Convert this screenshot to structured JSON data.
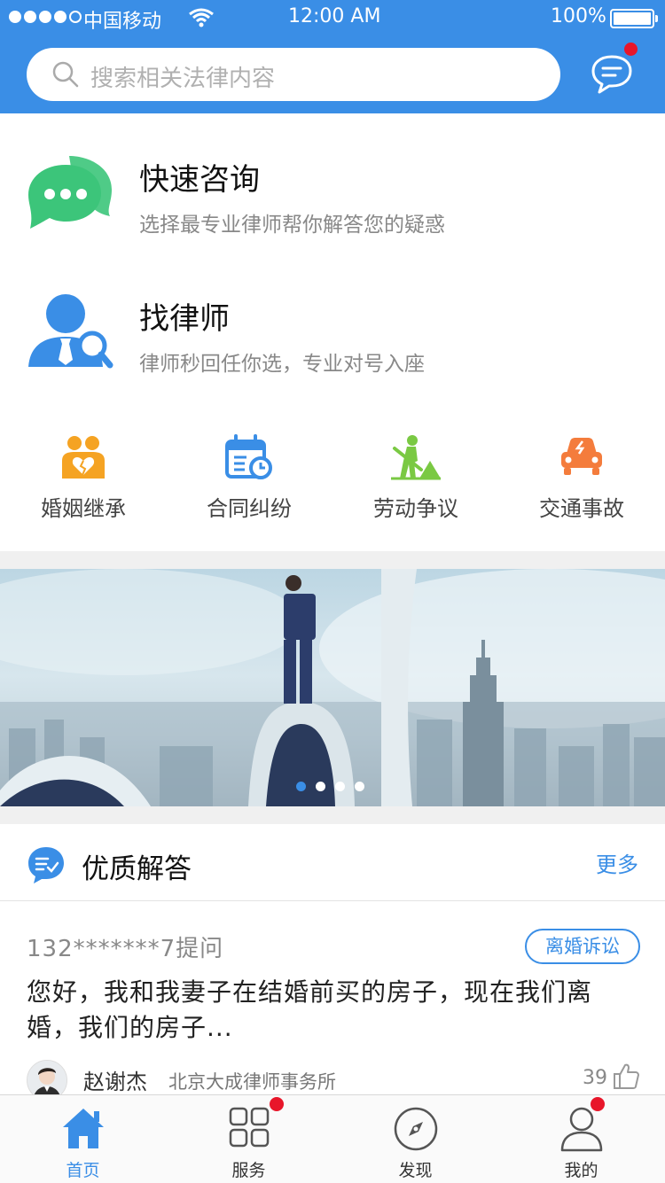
{
  "status_bar": {
    "carrier": "中国移动",
    "time": "12:00 AM",
    "battery": "100%"
  },
  "search": {
    "placeholder": "搜索相关法律内容"
  },
  "features": [
    {
      "title": "快速咨询",
      "subtitle": "选择最专业律师帮你解答您的疑惑",
      "icon": "chat-bubbles-icon",
      "color": "#3cc57a"
    },
    {
      "title": "找律师",
      "subtitle": "律师秒回任你选，专业对号入座",
      "icon": "lawyer-search-icon",
      "color": "#3a8ee6"
    }
  ],
  "categories": [
    {
      "label": "婚姻继承",
      "icon": "marriage-icon",
      "color": "#f5a323"
    },
    {
      "label": "合同纠纷",
      "icon": "contract-calendar-icon",
      "color": "#3a8ee6"
    },
    {
      "label": "劳动争议",
      "icon": "labor-worker-icon",
      "color": "#7ac943"
    },
    {
      "label": "交通事故",
      "icon": "traffic-car-icon",
      "color": "#f47c3c"
    }
  ],
  "banner": {
    "pages": 4,
    "active_page": 1
  },
  "section": {
    "title": "优质解答",
    "more": "更多"
  },
  "qa": {
    "asker": "132*******7提问",
    "tag": "离婚诉讼",
    "question": "您好，我和我妻子在结婚前买的房子，现在我们离婚，我们的房子...",
    "lawyer_name": "赵谢杰",
    "law_firm": "北京大成律师事务所",
    "likes": "39"
  },
  "tabbar": [
    {
      "label": "首页",
      "icon": "home-icon",
      "active": true,
      "badge": false
    },
    {
      "label": "服务",
      "icon": "grid-icon",
      "active": false,
      "badge": true
    },
    {
      "label": "发现",
      "icon": "compass-icon",
      "active": false,
      "badge": false
    },
    {
      "label": "我的",
      "icon": "user-icon",
      "active": false,
      "badge": true
    }
  ],
  "colors": {
    "primary": "#3a8ee6",
    "badge": "#e8162a"
  }
}
